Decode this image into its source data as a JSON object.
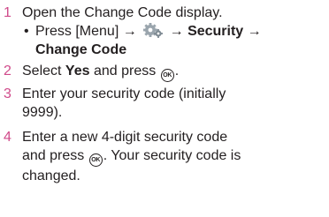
{
  "steps": [
    {
      "number": "1",
      "text": "Open the Change Code display.",
      "sub": {
        "bullet": "•",
        "prefix": "Press [Menu] →",
        "icon": "settings-gear-icon",
        "arrow1": "→",
        "security": "Security",
        "arrow2": "→",
        "change_code": "Change Code"
      }
    },
    {
      "number": "2",
      "pre": "Select",
      "bold": "Yes",
      "post": "and press",
      "ok_icon": "OK",
      "end": "."
    },
    {
      "number": "3",
      "line1": "Enter your security code (initially",
      "line2": "9999)."
    },
    {
      "number": "4",
      "line1": "Enter a new 4-digit security code",
      "line2_pre": "and press",
      "ok_icon": "OK",
      "line2_post": ". Your security code is",
      "line3": "changed."
    }
  ],
  "colors": {
    "step_number": "#d04a8a",
    "text": "#231f20"
  }
}
